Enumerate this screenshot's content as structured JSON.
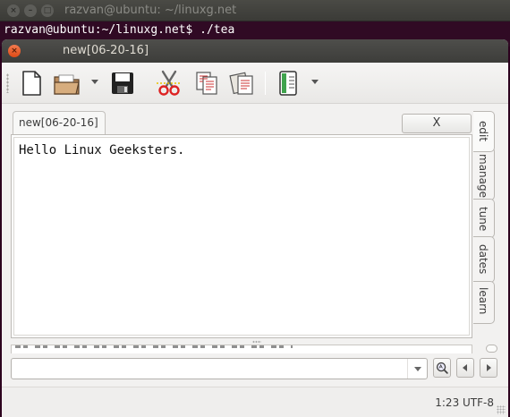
{
  "terminal": {
    "title": "razvan@ubuntu: ~/linuxg.net",
    "prompt_line": "razvan@ubuntu:~/linuxg.net$ ./tea"
  },
  "window": {
    "title": "new[06-20-16]"
  },
  "toolbar": {
    "icons": [
      "new-file-icon",
      "open-file-icon",
      "save-icon",
      "cut-icon",
      "copy-icon",
      "paste-icon",
      "bookmarks-icon"
    ]
  },
  "tabs": {
    "document_tab_label": "new[06-20-16]",
    "close_button_label": "X"
  },
  "editor": {
    "text": "Hello Linux Geeksters."
  },
  "side_tabs": [
    "edit",
    "manage",
    "tune",
    "dates",
    "learn"
  ],
  "fif": {
    "value": ""
  },
  "status": {
    "position_encoding": "1:23 UTF-8"
  },
  "colors": {
    "terminal_bg": "#300a24",
    "titlebar": "#3d3d3a",
    "close_button": "#df4a16",
    "window_bg": "#f2f1f0"
  }
}
